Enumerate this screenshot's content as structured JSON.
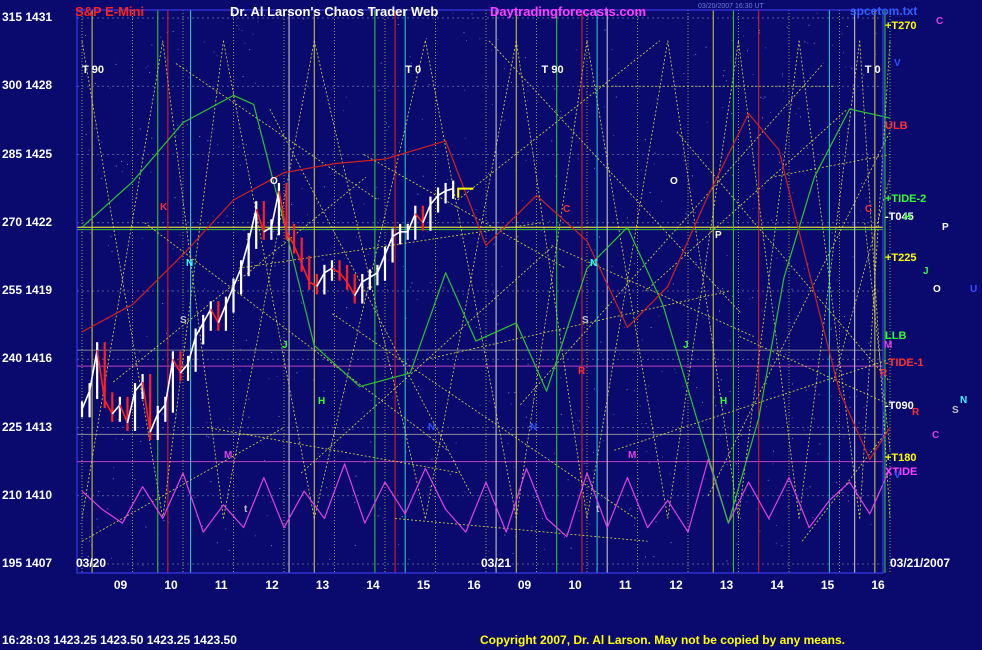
{
  "header": {
    "left": "S&P E-Mini",
    "center": "Dr. Al Larson's Chaos Trader Web",
    "site": "Daytradingforecasts.com",
    "stamp1": "03/20/2007 16:30 UT",
    "stamp2": "",
    "right": "spcetom.txt"
  },
  "footer": {
    "quote": "16:28:03  1423.25  1423.50  1423.25  1423.50",
    "copyright": "Copyright 2007, Dr. Al Larson. May not be copied by any means."
  },
  "colors": {
    "background": "#0a0a6e",
    "price_up": "#ffffff",
    "price_down": "#ff2020",
    "green_line": "#30c030",
    "red_line": "#d02020",
    "magenta_line": "#e040e0",
    "grid_yellow": "#e0e040"
  },
  "chart_data": {
    "type": "line",
    "title": "S&P E-Mini",
    "y_scale": {
      "left_numbers": [
        "315",
        "300",
        "285",
        "270",
        "255",
        "240",
        "225",
        "210",
        "195"
      ],
      "prices": [
        1431,
        1428,
        1425,
        1422,
        1419,
        1416,
        1413,
        1410,
        1407
      ],
      "ylim": [
        1407,
        1431
      ]
    },
    "x_axis": {
      "hours": [
        "09",
        "10",
        "11",
        "12",
        "13",
        "14",
        "15",
        "16",
        "09",
        "10",
        "11",
        "12",
        "13",
        "14",
        "15",
        "16"
      ],
      "date_labels": [
        "03/20",
        "03/21",
        "03/21/2007"
      ]
    },
    "price_series": {
      "name": "S&P E-Mini",
      "hour_offsets": [
        0,
        0.15,
        0.3,
        0.45,
        0.6,
        0.75,
        0.9,
        1.05,
        1.2,
        1.35,
        1.5,
        1.65,
        1.8,
        1.95,
        2.1,
        2.25,
        2.4,
        2.55,
        2.7,
        2.85,
        3.0,
        3.15,
        3.3,
        3.45,
        3.6,
        3.75,
        3.9,
        4.05,
        4.2,
        4.35,
        4.5,
        4.65,
        4.8,
        4.95,
        5.1,
        5.25,
        5.4,
        5.55,
        5.7,
        5.85,
        6.0,
        6.15,
        6.3,
        6.45,
        6.6,
        6.75,
        6.9,
        7.05,
        7.2,
        7.35
      ],
      "prices": [
        1413.8,
        1414.6,
        1416.4,
        1414.2,
        1413.6,
        1414.0,
        1413.2,
        1414.6,
        1415.0,
        1412.8,
        1413.6,
        1414.0,
        1416.0,
        1415.4,
        1415.8,
        1417.0,
        1417.6,
        1418.2,
        1417.6,
        1418.4,
        1419.2,
        1420.0,
        1421.2,
        1422.6,
        1421.6,
        1421.8,
        1423.4,
        1421.6,
        1421.0,
        1420.2,
        1419.4,
        1419.2,
        1419.8,
        1420.0,
        1419.8,
        1419.4,
        1418.8,
        1419.4,
        1419.6,
        1419.8,
        1420.6,
        1421.4,
        1421.6,
        1421.6,
        1422.4,
        1422.0,
        1422.8,
        1423.2,
        1423.4,
        1423.5
      ]
    },
    "green_line": {
      "name": "green flux line",
      "hour_offsets": [
        0,
        1,
        2,
        3,
        3.4,
        4,
        4.6,
        5.5,
        6.5,
        7.2,
        7.8,
        8.6,
        9.2,
        10,
        10.8,
        11.5,
        12.2,
        12.8,
        13.4,
        13.9,
        14.5,
        15.2,
        16
      ],
      "prices": [
        1421.8,
        1423.8,
        1426.4,
        1427.6,
        1427.2,
        1422.0,
        1416.6,
        1414.8,
        1415.4,
        1419.8,
        1416.8,
        1417.6,
        1414.6,
        1420.0,
        1421.8,
        1418.4,
        1413.2,
        1408.8,
        1413.4,
        1419.6,
        1424.0,
        1427.0,
        1426.6
      ]
    },
    "red_line": {
      "name": "red flux line",
      "hour_offsets": [
        0,
        1,
        2,
        3,
        4,
        5,
        6,
        7.2,
        8,
        9,
        10,
        10.8,
        11.6,
        12.4,
        13.2,
        13.8,
        14.4,
        15,
        15.6,
        16
      ],
      "prices": [
        1417.2,
        1418.4,
        1420.6,
        1423.0,
        1424.2,
        1424.6,
        1424.8,
        1425.6,
        1421.0,
        1423.2,
        1421.2,
        1417.4,
        1419.2,
        1423.2,
        1426.8,
        1425.2,
        1419.8,
        1414.6,
        1411.6,
        1413.0
      ]
    },
    "magenta_series": {
      "name": "XTIDE",
      "hour_offsets": [
        0,
        0.4,
        0.8,
        1.2,
        1.6,
        2.0,
        2.4,
        2.8,
        3.2,
        3.6,
        4.0,
        4.4,
        4.8,
        5.2,
        5.6,
        6.0,
        6.4,
        6.8,
        7.2,
        7.6,
        8.0,
        8.4,
        8.8,
        9.2,
        9.6,
        10.0,
        10.4,
        10.8,
        11.2,
        11.6,
        12.0,
        12.4,
        12.8,
        13.2,
        13.6,
        14.0,
        14.4,
        14.8,
        15.2,
        15.6,
        16.0
      ],
      "prices": [
        1410.2,
        1409.4,
        1408.8,
        1410.4,
        1409.0,
        1411.0,
        1408.4,
        1409.6,
        1408.6,
        1410.8,
        1408.6,
        1410.2,
        1409.0,
        1411.4,
        1408.8,
        1410.6,
        1409.2,
        1411.2,
        1409.4,
        1408.4,
        1410.6,
        1408.4,
        1411.2,
        1409.0,
        1408.2,
        1411.0,
        1408.6,
        1410.8,
        1408.6,
        1409.8,
        1408.4,
        1411.6,
        1408.8,
        1410.6,
        1409.0,
        1410.8,
        1408.6,
        1409.8,
        1410.6,
        1409.2,
        1411.2
      ]
    },
    "right_labels": [
      {
        "text": "+T270",
        "price": 1430.6,
        "color": "#ffff00"
      },
      {
        "text": "ULB",
        "price": 1426.2,
        "color": "#ff3030"
      },
      {
        "text": "+TIDE-2",
        "price": 1423.0,
        "color": "#30ff30"
      },
      {
        "text": "-T045",
        "price": 1422.2,
        "color": "#ffffff"
      },
      {
        "text": "+T225",
        "price": 1420.4,
        "color": "#ffff00"
      },
      {
        "text": "LLB",
        "price": 1417.0,
        "color": "#30ff30"
      },
      {
        "text": "-TIDE-1",
        "price": 1415.8,
        "color": "#ff3030"
      },
      {
        "text": "-T090",
        "price": 1413.9,
        "color": "#ffffff"
      },
      {
        "text": "+T180",
        "price": 1411.6,
        "color": "#ffff00"
      },
      {
        "text": "XTIDE",
        "price": 1411.0,
        "color": "#ff40ff"
      }
    ],
    "top_labels": [
      "T 90",
      "T 0",
      "T 90",
      "T 0"
    ],
    "flux_letters": [
      {
        "text": "C",
        "x": 936,
        "y": 16,
        "color": "#e040e0"
      },
      {
        "text": "V",
        "x": 894,
        "y": 58,
        "color": "#3050ff"
      },
      {
        "text": "O",
        "x": 270,
        "y": 176,
        "color": "#ffffff"
      },
      {
        "text": "O",
        "x": 670,
        "y": 176,
        "color": "#ffffff"
      },
      {
        "text": "K",
        "x": 160,
        "y": 202,
        "color": "#ff3030"
      },
      {
        "text": "C",
        "x": 563,
        "y": 204,
        "color": "#ff3030"
      },
      {
        "text": "C",
        "x": 865,
        "y": 204,
        "color": "#ff3030"
      },
      {
        "text": "H",
        "x": 904,
        "y": 212,
        "color": "#30ff30"
      },
      {
        "text": "P",
        "x": 942,
        "y": 222,
        "color": "#ffffff"
      },
      {
        "text": "P",
        "x": 715,
        "y": 230,
        "color": "#ffffff"
      },
      {
        "text": "N",
        "x": 186,
        "y": 258,
        "color": "#30ffff"
      },
      {
        "text": "N",
        "x": 590,
        "y": 258,
        "color": "#30ffff"
      },
      {
        "text": "J",
        "x": 923,
        "y": 266,
        "color": "#30ff30"
      },
      {
        "text": "O",
        "x": 933,
        "y": 284,
        "color": "#ffffff"
      },
      {
        "text": "U",
        "x": 970,
        "y": 284,
        "color": "#3050ff"
      },
      {
        "text": "S",
        "x": 180,
        "y": 315,
        "color": "#c0c0c0"
      },
      {
        "text": "S",
        "x": 582,
        "y": 315,
        "color": "#c0c0c0"
      },
      {
        "text": "J",
        "x": 282,
        "y": 340,
        "color": "#30ff30"
      },
      {
        "text": "J",
        "x": 683,
        "y": 340,
        "color": "#30ff30"
      },
      {
        "text": "M",
        "x": 884,
        "y": 340,
        "color": "#e040e0"
      },
      {
        "text": "R",
        "x": 578,
        "y": 366,
        "color": "#ff3030"
      },
      {
        "text": "R",
        "x": 880,
        "y": 368,
        "color": "#ff3030"
      },
      {
        "text": "H",
        "x": 318,
        "y": 396,
        "color": "#30ff30"
      },
      {
        "text": "H",
        "x": 720,
        "y": 396,
        "color": "#30ff30"
      },
      {
        "text": "N",
        "x": 960,
        "y": 395,
        "color": "#30ffff"
      },
      {
        "text": "S",
        "x": 952,
        "y": 405,
        "color": "#c0c0c0"
      },
      {
        "text": "R",
        "x": 912,
        "y": 407,
        "color": "#ff3030"
      },
      {
        "text": "N",
        "x": 428,
        "y": 422,
        "color": "#3050ff"
      },
      {
        "text": "N",
        "x": 530,
        "y": 422,
        "color": "#3050ff"
      },
      {
        "text": "C",
        "x": 932,
        "y": 430,
        "color": "#e040e0"
      },
      {
        "text": "M",
        "x": 224,
        "y": 450,
        "color": "#e040e0"
      },
      {
        "text": "M",
        "x": 628,
        "y": 450,
        "color": "#e040e0"
      },
      {
        "text": "V",
        "x": 894,
        "y": 470,
        "color": "#3050ff"
      },
      {
        "text": "t",
        "x": 244,
        "y": 504,
        "color": "#c0c0c0"
      },
      {
        "text": "t",
        "x": 596,
        "y": 504,
        "color": "#c0c0c0"
      }
    ]
  }
}
